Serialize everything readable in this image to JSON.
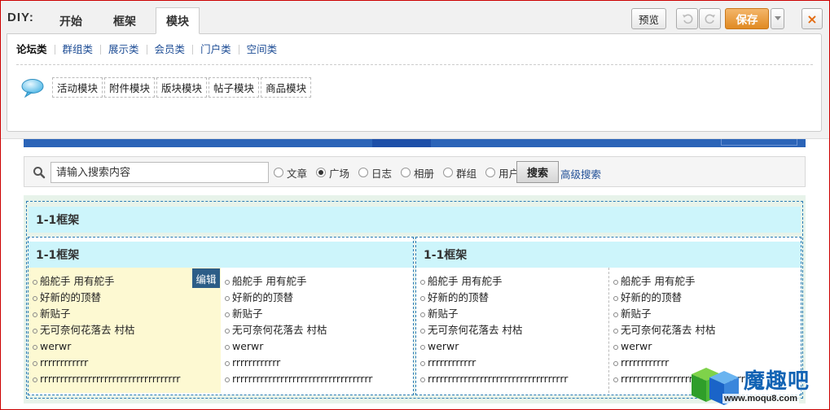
{
  "diy": {
    "label": "DIY:",
    "tabs": [
      {
        "label": "开始"
      },
      {
        "label": "框架"
      },
      {
        "label": "模块"
      }
    ],
    "active_tab": "模块",
    "toolbar": {
      "preview": "预览",
      "save": "保存",
      "close_icon": "×"
    },
    "categories": [
      "论坛类",
      "群组类",
      "展示类",
      "会员类",
      "门户类",
      "空间类"
    ],
    "active_category": "论坛类",
    "modules": [
      "活动模块",
      "附件模块",
      "版块模块",
      "帖子模块",
      "商品模块"
    ]
  },
  "search": {
    "placeholder": "请输入搜索内容",
    "options": [
      {
        "label": "文章",
        "checked": false
      },
      {
        "label": "广场",
        "checked": true
      },
      {
        "label": "日志",
        "checked": false
      },
      {
        "label": "相册",
        "checked": false
      },
      {
        "label": "群组",
        "checked": false
      },
      {
        "label": "用户",
        "checked": false
      }
    ],
    "button": "搜索",
    "advanced": "高级搜索"
  },
  "frames": {
    "outer_title": "1-1框架",
    "left_title": "1-1框架",
    "right_title": "1-1框架",
    "edit_label": "编辑",
    "list_items": [
      "船舵手 用有舵手",
      "好新的的顶替",
      "新贴子",
      "无可奈何花落去 村枯",
      "werwr",
      "rrrrrrrrrrrr",
      "rrrrrrrrrrrrrrrrrrrrrrrrrrrrrrrrrrr"
    ]
  },
  "watermark": {
    "title": "魔趣吧",
    "url": "www.moqu8.com"
  },
  "colors": {
    "accent_save": "#e08a22",
    "frame_title_bg": "#cdf5fb",
    "selected_column_bg": "#fdf9d2",
    "link": "#1f4e96",
    "edit_button": "#2c5d87",
    "dashed_border": "#2a7cb5"
  }
}
